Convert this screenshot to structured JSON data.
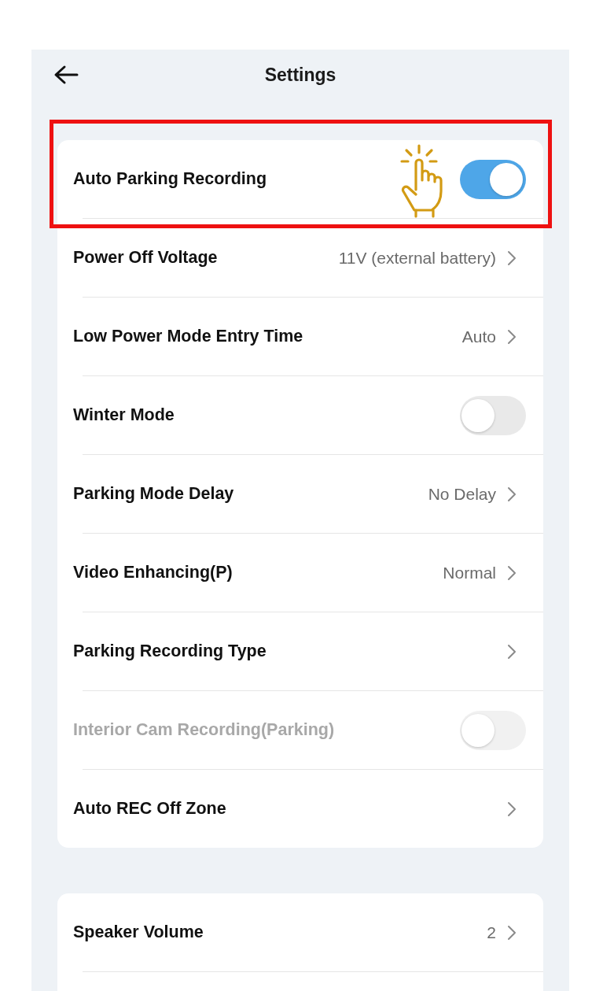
{
  "header": {
    "title": "Settings"
  },
  "groups": [
    {
      "rows": [
        {
          "kind": "toggle",
          "label": "Auto Parking Recording",
          "on": true,
          "disabled": false,
          "highlighted": true
        },
        {
          "kind": "nav",
          "label": "Power Off Voltage",
          "value": "11V (external battery)"
        },
        {
          "kind": "nav",
          "label": "Low Power Mode Entry Time",
          "value": "Auto"
        },
        {
          "kind": "toggle",
          "label": "Winter Mode",
          "on": false,
          "disabled": false,
          "highlighted": false
        },
        {
          "kind": "nav",
          "label": "Parking Mode Delay",
          "value": "No Delay"
        },
        {
          "kind": "nav",
          "label": "Video Enhancing(P)",
          "value": "Normal"
        },
        {
          "kind": "nav",
          "label": "Parking Recording Type"
        },
        {
          "kind": "toggle",
          "label": "Interior Cam Recording(Parking)",
          "on": false,
          "disabled": true,
          "highlighted": false
        },
        {
          "kind": "nav",
          "label": "Auto REC Off Zone"
        }
      ]
    },
    {
      "rows": [
        {
          "kind": "nav",
          "label": "Speaker Volume",
          "value": "2"
        }
      ]
    }
  ]
}
